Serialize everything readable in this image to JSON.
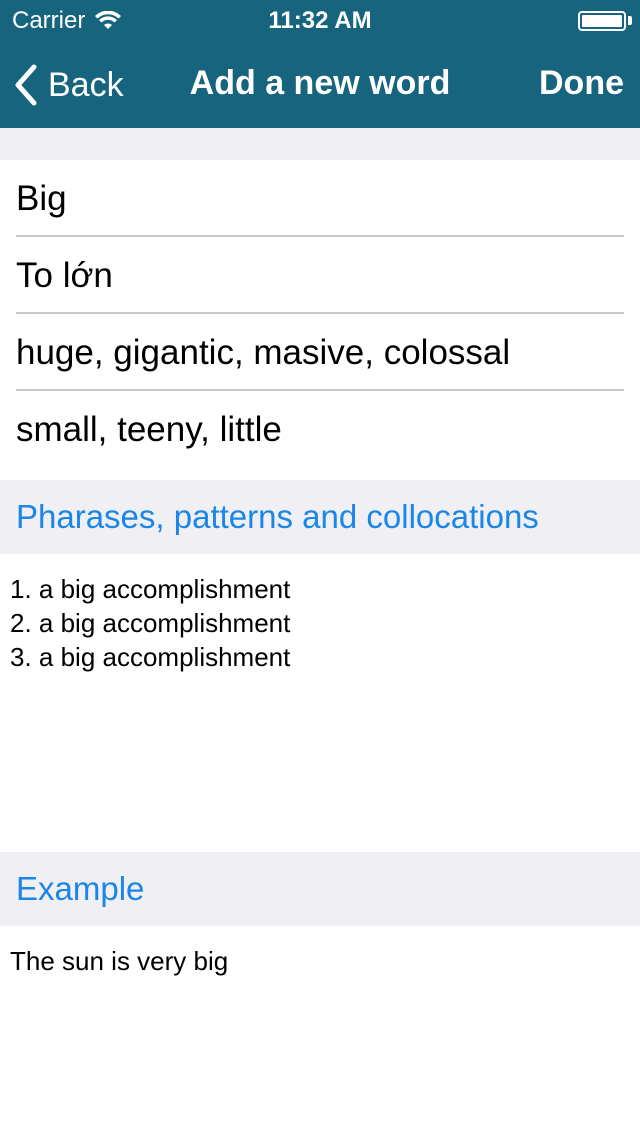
{
  "status_bar": {
    "carrier": "Carrier",
    "time": "11:32 AM"
  },
  "navbar": {
    "back_label": "Back",
    "title": "Add a new word",
    "done_label": "Done",
    "background_color": "#17647f"
  },
  "fields": {
    "word": "Big",
    "meaning": "To lớn",
    "synonyms": "huge, gigantic, masive, colossal",
    "antonyms": "small, teeny, little"
  },
  "phrases": {
    "header": "Pharases, patterns and collocations",
    "items": [
      "1. a big accomplishment",
      "2. a big accomplishment",
      "3. a big accomplishment"
    ]
  },
  "example": {
    "header": "Example",
    "text": "The sun is very big"
  },
  "colors": {
    "section_header_text": "#1a86e8",
    "section_header_bg": "#efeff4"
  }
}
